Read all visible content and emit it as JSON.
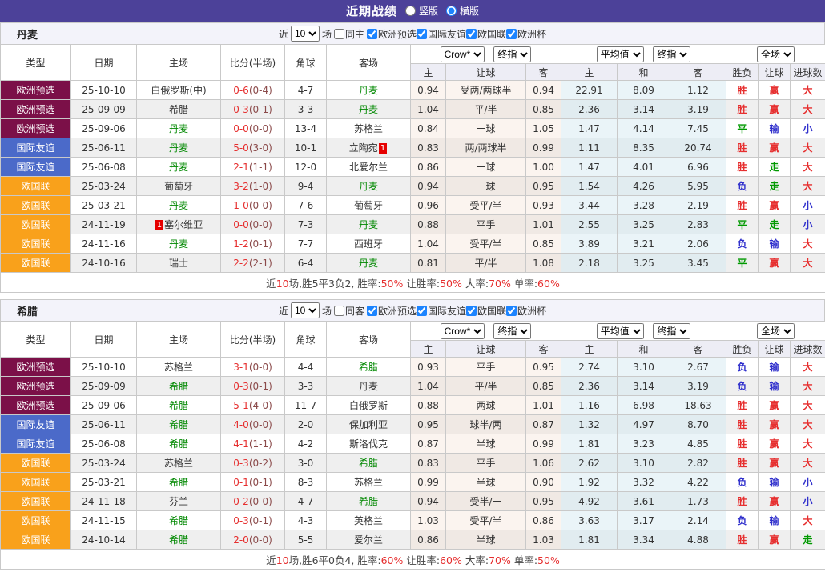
{
  "topbar": {
    "title": "近期战绩",
    "radio_vertical": "竖版",
    "radio_horizontal": "横版",
    "selected": "横版"
  },
  "colors": {
    "topbar_bg": "#4C4199",
    "focus_team": "#008800",
    "score": "#E62E2E",
    "checkbox_accent": "#1C84FF"
  },
  "comp_colors": {
    "欧洲预选": "#7B1048",
    "国际友谊": "#4B6AC9",
    "欧国联": "#F9A11B"
  },
  "result_palette": {
    "red": "#E62E2E",
    "green": "#009900",
    "blue": "#3030CC"
  },
  "result_colors": {
    "胜": "red",
    "平": "green",
    "负": "blue",
    "赢": "red",
    "走": "green",
    "输": "blue",
    "大": "red",
    "小": "blue"
  },
  "columns": {
    "left": [
      "类型",
      "日期",
      "主场",
      "比分(半场)",
      "角球",
      "客场"
    ],
    "group1_selects": [
      "Crow*",
      "终指"
    ],
    "group2_selects": [
      "平均值",
      "终指"
    ],
    "group3_selects": [
      "全场"
    ],
    "sub": [
      "主",
      "让球",
      "客",
      "主",
      "和",
      "客",
      "胜负",
      "让球",
      "进球数"
    ]
  },
  "sections": [
    {
      "team": "丹麦",
      "filter": {
        "near": "近",
        "count": "10",
        "games": "场",
        "same": {
          "label": "同主",
          "checked": false
        },
        "comps": [
          {
            "label": "欧洲预选",
            "checked": true
          },
          {
            "label": "国际友谊",
            "checked": true
          },
          {
            "label": "欧国联",
            "checked": true
          },
          {
            "label": "欧洲杯",
            "checked": true
          }
        ]
      },
      "rows": [
        {
          "comp": "欧洲预选",
          "date": "25-10-10",
          "home": "白俄罗斯(中)",
          "home_card": "",
          "away": "丹麦",
          "away_card": "",
          "focus": "away",
          "score": "0-6",
          "half": "0-4",
          "corner": "4-7",
          "let_home": "0.94",
          "let_line": "受两/两球半",
          "let_away": "0.94",
          "avg_home": "22.91",
          "avg_draw": "8.09",
          "avg_away": "1.12",
          "res": "胜",
          "res_let": "赢",
          "res_goal": "大"
        },
        {
          "comp": "欧洲预选",
          "date": "25-09-09",
          "home": "希腊",
          "home_card": "",
          "away": "丹麦",
          "away_card": "",
          "focus": "away",
          "score": "0-3",
          "half": "0-1",
          "corner": "3-3",
          "let_home": "1.04",
          "let_line": "平/半",
          "let_away": "0.85",
          "avg_home": "2.36",
          "avg_draw": "3.14",
          "avg_away": "3.19",
          "res": "胜",
          "res_let": "赢",
          "res_goal": "大"
        },
        {
          "comp": "欧洲预选",
          "date": "25-09-06",
          "home": "丹麦",
          "home_card": "",
          "away": "苏格兰",
          "away_card": "",
          "focus": "home",
          "score": "0-0",
          "half": "0-0",
          "corner": "13-4",
          "let_home": "0.84",
          "let_line": "一球",
          "let_away": "1.05",
          "avg_home": "1.47",
          "avg_draw": "4.14",
          "avg_away": "7.45",
          "res": "平",
          "res_let": "输",
          "res_goal": "小"
        },
        {
          "comp": "国际友谊",
          "date": "25-06-11",
          "home": "丹麦",
          "home_card": "",
          "away": "立陶宛",
          "away_card": "1",
          "focus": "home",
          "score": "5-0",
          "half": "3-0",
          "corner": "10-1",
          "let_home": "0.83",
          "let_line": "两/两球半",
          "let_away": "0.99",
          "avg_home": "1.11",
          "avg_draw": "8.35",
          "avg_away": "20.74",
          "res": "胜",
          "res_let": "赢",
          "res_goal": "大"
        },
        {
          "comp": "国际友谊",
          "date": "25-06-08",
          "home": "丹麦",
          "home_card": "",
          "away": "北爱尔兰",
          "away_card": "",
          "focus": "home",
          "score": "2-1",
          "half": "1-1",
          "corner": "12-0",
          "let_home": "0.86",
          "let_line": "一球",
          "let_away": "1.00",
          "avg_home": "1.47",
          "avg_draw": "4.01",
          "avg_away": "6.96",
          "res": "胜",
          "res_let": "走",
          "res_goal": "大"
        },
        {
          "comp": "欧国联",
          "date": "25-03-24",
          "home": "葡萄牙",
          "home_card": "",
          "away": "丹麦",
          "away_card": "",
          "focus": "away",
          "score": "3-2",
          "half": "1-0",
          "corner": "9-4",
          "let_home": "0.94",
          "let_line": "一球",
          "let_away": "0.95",
          "avg_home": "1.54",
          "avg_draw": "4.26",
          "avg_away": "5.95",
          "res": "负",
          "res_let": "走",
          "res_goal": "大"
        },
        {
          "comp": "欧国联",
          "date": "25-03-21",
          "home": "丹麦",
          "home_card": "",
          "away": "葡萄牙",
          "away_card": "",
          "focus": "home",
          "score": "1-0",
          "half": "0-0",
          "corner": "7-6",
          "let_home": "0.96",
          "let_line": "受平/半",
          "let_away": "0.93",
          "avg_home": "3.44",
          "avg_draw": "3.28",
          "avg_away": "2.19",
          "res": "胜",
          "res_let": "赢",
          "res_goal": "小"
        },
        {
          "comp": "欧国联",
          "date": "24-11-19",
          "home": "塞尔维亚",
          "home_card": "1",
          "away": "丹麦",
          "away_card": "",
          "focus": "away",
          "score": "0-0",
          "half": "0-0",
          "corner": "7-3",
          "let_home": "0.88",
          "let_line": "平手",
          "let_away": "1.01",
          "avg_home": "2.55",
          "avg_draw": "3.25",
          "avg_away": "2.83",
          "res": "平",
          "res_let": "走",
          "res_goal": "小"
        },
        {
          "comp": "欧国联",
          "date": "24-11-16",
          "home": "丹麦",
          "home_card": "",
          "away": "西班牙",
          "away_card": "",
          "focus": "home",
          "score": "1-2",
          "half": "0-1",
          "corner": "7-7",
          "let_home": "1.04",
          "let_line": "受平/半",
          "let_away": "0.85",
          "avg_home": "3.89",
          "avg_draw": "3.21",
          "avg_away": "2.06",
          "res": "负",
          "res_let": "输",
          "res_goal": "大"
        },
        {
          "comp": "欧国联",
          "date": "24-10-16",
          "home": "瑞士",
          "home_card": "",
          "away": "丹麦",
          "away_card": "",
          "focus": "away",
          "score": "2-2",
          "half": "2-1",
          "corner": "6-4",
          "let_home": "0.81",
          "let_line": "平/半",
          "let_away": "1.08",
          "avg_home": "2.18",
          "avg_draw": "3.25",
          "avg_away": "3.45",
          "res": "平",
          "res_let": "赢",
          "res_goal": "大"
        }
      ],
      "summary": {
        "lead": "近",
        "count": "10",
        "record": "场,胜5平3负2,",
        "stats": [
          {
            "label": "胜率:",
            "value": "50%"
          },
          {
            "label": "让胜率:",
            "value": "50%"
          },
          {
            "label": "大率:",
            "value": "70%"
          },
          {
            "label": "单率:",
            "value": "60%"
          }
        ]
      }
    },
    {
      "team": "希腊",
      "filter": {
        "near": "近",
        "count": "10",
        "games": "场",
        "same": {
          "label": "同客",
          "checked": false
        },
        "comps": [
          {
            "label": "欧洲预选",
            "checked": true
          },
          {
            "label": "国际友谊",
            "checked": true
          },
          {
            "label": "欧国联",
            "checked": true
          },
          {
            "label": "欧洲杯",
            "checked": true
          }
        ]
      },
      "rows": [
        {
          "comp": "欧洲预选",
          "date": "25-10-10",
          "home": "苏格兰",
          "home_card": "",
          "away": "希腊",
          "away_card": "",
          "focus": "away",
          "score": "3-1",
          "half": "0-0",
          "corner": "4-4",
          "let_home": "0.93",
          "let_line": "平手",
          "let_away": "0.95",
          "avg_home": "2.74",
          "avg_draw": "3.10",
          "avg_away": "2.67",
          "res": "负",
          "res_let": "输",
          "res_goal": "大"
        },
        {
          "comp": "欧洲预选",
          "date": "25-09-09",
          "home": "希腊",
          "home_card": "",
          "away": "丹麦",
          "away_card": "",
          "focus": "home",
          "score": "0-3",
          "half": "0-1",
          "corner": "3-3",
          "let_home": "1.04",
          "let_line": "平/半",
          "let_away": "0.85",
          "avg_home": "2.36",
          "avg_draw": "3.14",
          "avg_away": "3.19",
          "res": "负",
          "res_let": "输",
          "res_goal": "大"
        },
        {
          "comp": "欧洲预选",
          "date": "25-09-06",
          "home": "希腊",
          "home_card": "",
          "away": "白俄罗斯",
          "away_card": "",
          "focus": "home",
          "score": "5-1",
          "half": "4-0",
          "corner": "11-7",
          "let_home": "0.88",
          "let_line": "两球",
          "let_away": "1.01",
          "avg_home": "1.16",
          "avg_draw": "6.98",
          "avg_away": "18.63",
          "res": "胜",
          "res_let": "赢",
          "res_goal": "大"
        },
        {
          "comp": "国际友谊",
          "date": "25-06-11",
          "home": "希腊",
          "home_card": "",
          "away": "保加利亚",
          "away_card": "",
          "focus": "home",
          "score": "4-0",
          "half": "0-0",
          "corner": "2-0",
          "let_home": "0.95",
          "let_line": "球半/两",
          "let_away": "0.87",
          "avg_home": "1.32",
          "avg_draw": "4.97",
          "avg_away": "8.70",
          "res": "胜",
          "res_let": "赢",
          "res_goal": "大"
        },
        {
          "comp": "国际友谊",
          "date": "25-06-08",
          "home": "希腊",
          "home_card": "",
          "away": "斯洛伐克",
          "away_card": "",
          "focus": "home",
          "score": "4-1",
          "half": "1-1",
          "corner": "4-2",
          "let_home": "0.87",
          "let_line": "半球",
          "let_away": "0.99",
          "avg_home": "1.81",
          "avg_draw": "3.23",
          "avg_away": "4.85",
          "res": "胜",
          "res_let": "赢",
          "res_goal": "大"
        },
        {
          "comp": "欧国联",
          "date": "25-03-24",
          "home": "苏格兰",
          "home_card": "",
          "away": "希腊",
          "away_card": "",
          "focus": "away",
          "score": "0-3",
          "half": "0-2",
          "corner": "3-0",
          "let_home": "0.83",
          "let_line": "平手",
          "let_away": "1.06",
          "avg_home": "2.62",
          "avg_draw": "3.10",
          "avg_away": "2.82",
          "res": "胜",
          "res_let": "赢",
          "res_goal": "大"
        },
        {
          "comp": "欧国联",
          "date": "25-03-21",
          "home": "希腊",
          "home_card": "",
          "away": "苏格兰",
          "away_card": "",
          "focus": "home",
          "score": "0-1",
          "half": "0-1",
          "corner": "8-3",
          "let_home": "0.99",
          "let_line": "半球",
          "let_away": "0.90",
          "avg_home": "1.92",
          "avg_draw": "3.32",
          "avg_away": "4.22",
          "res": "负",
          "res_let": "输",
          "res_goal": "小"
        },
        {
          "comp": "欧国联",
          "date": "24-11-18",
          "home": "芬兰",
          "home_card": "",
          "away": "希腊",
          "away_card": "",
          "focus": "away",
          "score": "0-2",
          "half": "0-0",
          "corner": "4-7",
          "let_home": "0.94",
          "let_line": "受半/一",
          "let_away": "0.95",
          "avg_home": "4.92",
          "avg_draw": "3.61",
          "avg_away": "1.73",
          "res": "胜",
          "res_let": "赢",
          "res_goal": "小"
        },
        {
          "comp": "欧国联",
          "date": "24-11-15",
          "home": "希腊",
          "home_card": "",
          "away": "英格兰",
          "away_card": "",
          "focus": "home",
          "score": "0-3",
          "half": "0-1",
          "corner": "4-3",
          "let_home": "1.03",
          "let_line": "受平/半",
          "let_away": "0.86",
          "avg_home": "3.63",
          "avg_draw": "3.17",
          "avg_away": "2.14",
          "res": "负",
          "res_let": "输",
          "res_goal": "大"
        },
        {
          "comp": "欧国联",
          "date": "24-10-14",
          "home": "希腊",
          "home_card": "",
          "away": "爱尔兰",
          "away_card": "",
          "focus": "home",
          "score": "2-0",
          "half": "0-0",
          "corner": "5-5",
          "let_home": "0.86",
          "let_line": "半球",
          "let_away": "1.03",
          "avg_home": "1.81",
          "avg_draw": "3.34",
          "avg_away": "4.88",
          "res": "胜",
          "res_let": "赢",
          "res_goal": "走"
        }
      ],
      "summary": {
        "lead": "近",
        "count": "10",
        "record": "场,胜6平0负4,",
        "stats": [
          {
            "label": "胜率:",
            "value": "60%"
          },
          {
            "label": "让胜率:",
            "value": "60%"
          },
          {
            "label": "大率:",
            "value": "70%"
          },
          {
            "label": "单率:",
            "value": "50%"
          }
        ]
      }
    }
  ]
}
